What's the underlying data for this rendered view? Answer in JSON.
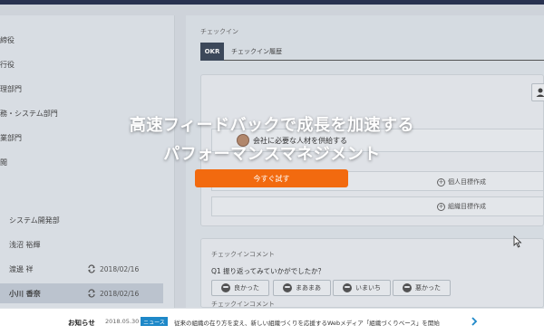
{
  "sidebar": {
    "departments": [
      "締役",
      "行役",
      "理部門",
      "務・システム部門",
      "業部門",
      "閲"
    ],
    "group_label": "システム開発部",
    "people": [
      {
        "name": "浅沼 裕輝",
        "date": ""
      },
      {
        "name": "渡邊 祥",
        "date": "2018/02/16"
      },
      {
        "name": "小川 香奈",
        "date": "2018/02/16",
        "active": true
      }
    ]
  },
  "main": {
    "section_checkin": "チェックイン",
    "tab_okr": "OKR",
    "tab_history": "チェックイン履歴",
    "goal_title": "会社に必要な人材を供給する",
    "add_personal_goal": "個人目標作成",
    "add_org_goal": "組織目標作成",
    "section_comment": "チェックインコメント",
    "question": "Q1 振り返ってみていかがでしたか？",
    "moods": [
      "良かった",
      "まあまあ",
      "いまいち",
      "悪かった"
    ],
    "section_comment2": "チェックインコメント"
  },
  "hero": {
    "line1": "高速フィードバックで成長を加速する",
    "line2": "パフォーマンスマネジメント",
    "cta_label": "今すぐ試す"
  },
  "news": {
    "label": "お知らせ",
    "date": "2018.05.30",
    "badge": "ニュース",
    "text": "従来の組織の在り方を変え、新しい組織づくりを応援するWebメディア「組織づくりベース」を開始"
  },
  "colors": {
    "accent": "#f26a0f",
    "badge": "#1e88c8",
    "topbar": "#2a3352"
  }
}
